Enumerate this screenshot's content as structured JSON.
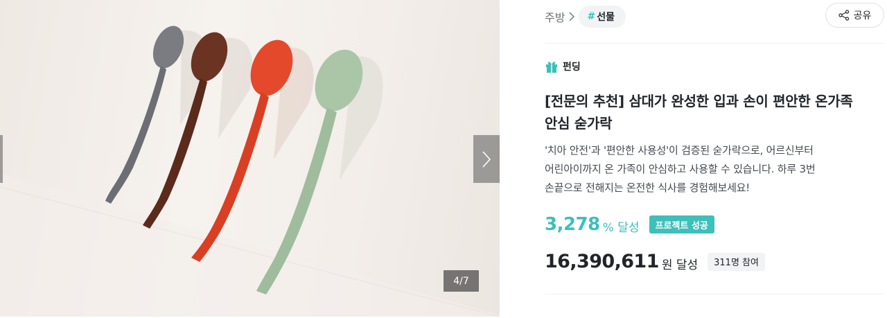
{
  "gallery": {
    "counter": "4/7",
    "spoon_colors": [
      "#74767b",
      "#6a3220",
      "#e2482a",
      "#a8c3a5"
    ]
  },
  "breadcrumb": {
    "category": "주방",
    "tag_hash": "#",
    "tag": "선물"
  },
  "share": {
    "label": "공유"
  },
  "project": {
    "type_label": "펀딩",
    "title_line1": "[전문의 추천] 삼대가 완성한 입과 손이 편안한 온가족",
    "title_line2": "안심 숟가락",
    "desc_line1": "'치아 안전'과 '편안한 사용성'이 검증된 숟가락으로, 어르신부터",
    "desc_line2": "어린아이까지 온 가족이 안심하고 사용할 수 있습니다. 하루 3번",
    "desc_line3": "손끝으로 전해지는 온전한 식사를 경험해보세요!"
  },
  "stats": {
    "rate": "3,278",
    "rate_unit": "% 달성",
    "status_badge": "프로젝트 성공",
    "amount": "16,390,611",
    "amount_unit": "원 달성",
    "participants": "311명 참여"
  },
  "colors": {
    "accent": "#3dbfba"
  }
}
